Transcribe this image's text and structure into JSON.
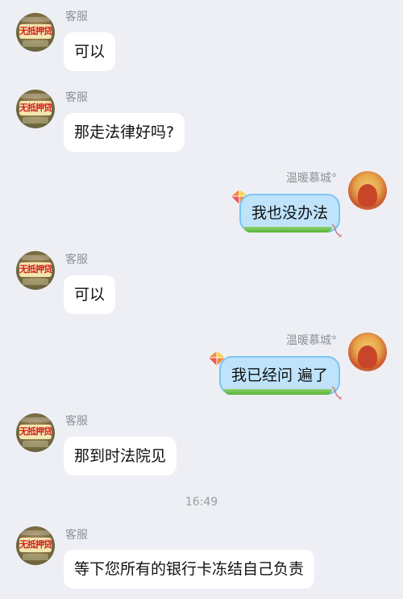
{
  "timestamp": "16:49",
  "agent": {
    "name": "客服",
    "avatar_text": "无抵押贷"
  },
  "user": {
    "name": "温暖慕城°"
  },
  "messages": [
    {
      "from": "agent",
      "text": "可以"
    },
    {
      "from": "agent",
      "text": "那走法律好吗?"
    },
    {
      "from": "user",
      "text": "我也没办法"
    },
    {
      "from": "agent",
      "text": "可以"
    },
    {
      "from": "user",
      "text": "我已经问 遍了"
    },
    {
      "from": "agent",
      "text": "那到时法院见"
    },
    {
      "from": "agent",
      "text": "等下您所有的银行卡冻结自己负责"
    }
  ],
  "colors": {
    "background": "#eeeff4",
    "agent_bubble": "#ffffff",
    "user_bubble": "#bfe3fb",
    "user_bubble_border": "#7cc5f3",
    "meta_text": "#8f9298"
  }
}
